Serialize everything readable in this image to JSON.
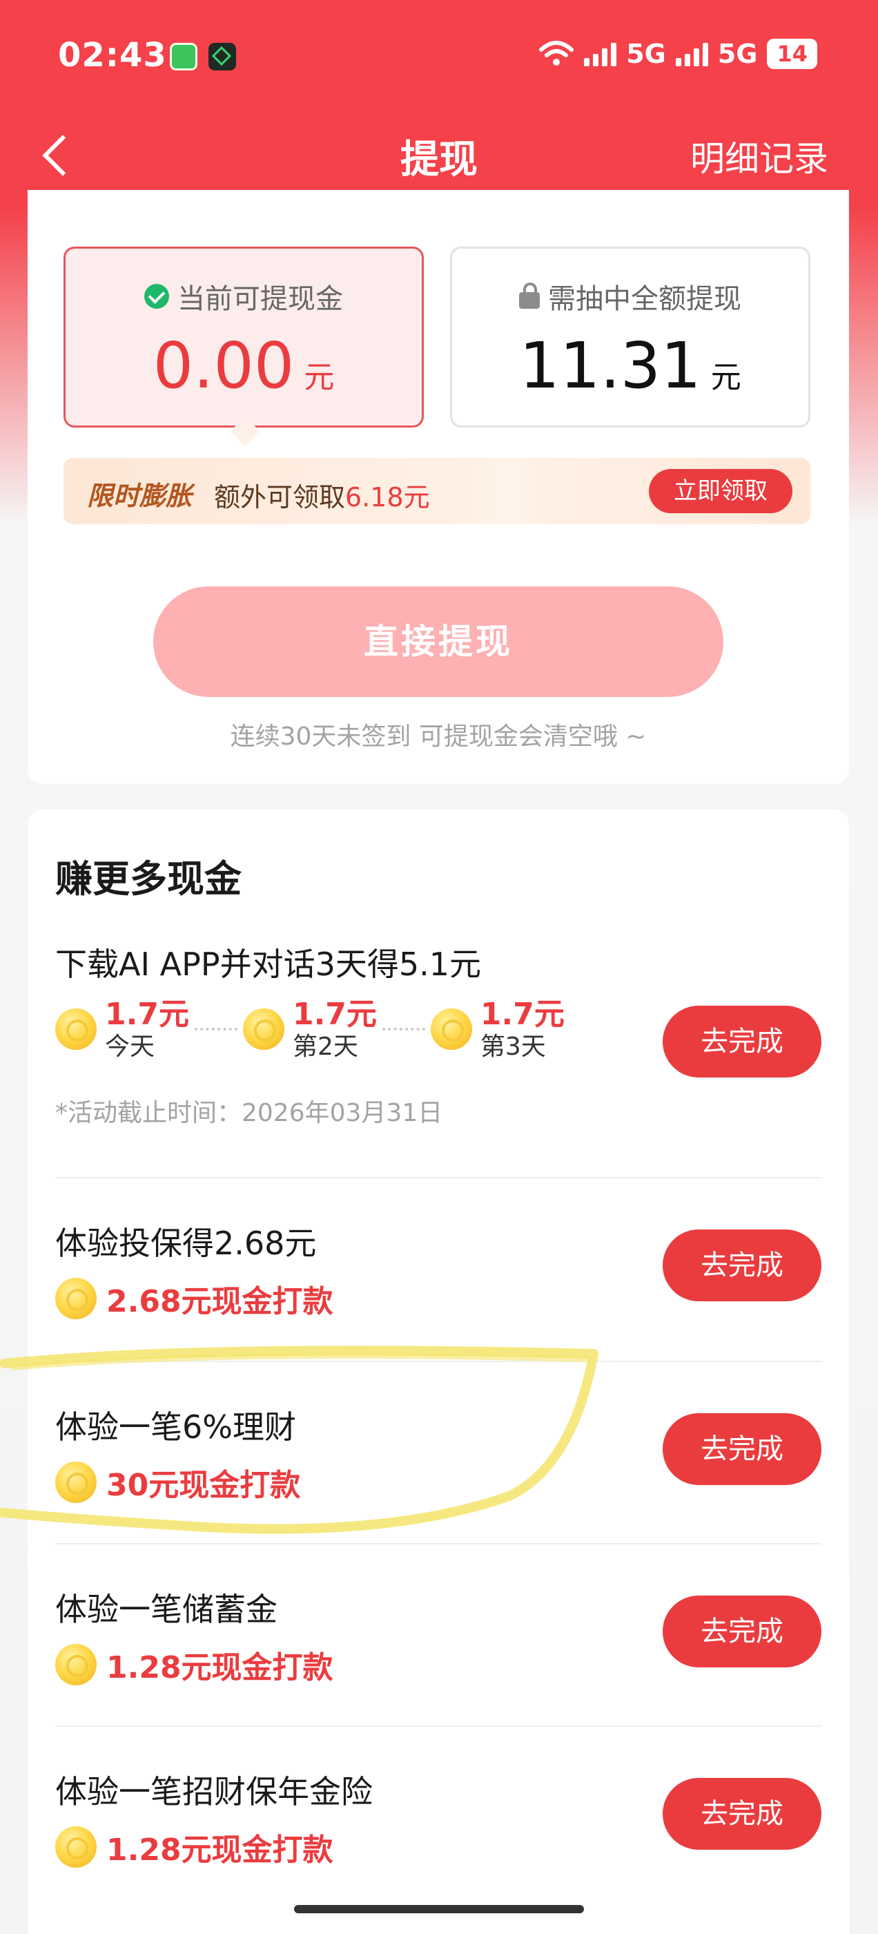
{
  "status_bar": {
    "time": "02:43",
    "network_1": "5G",
    "network_2": "5G",
    "battery": "14"
  },
  "header": {
    "title": "提现",
    "detail_link": "明细记录"
  },
  "balance": {
    "available_label": "当前可提现金",
    "available_amount": "0.00",
    "available_unit": "元",
    "locked_label": "需抽中全额提现",
    "locked_amount": "11.31",
    "locked_unit": "元"
  },
  "promo": {
    "tag": "限时膨胀",
    "text_prefix": "额外可领取",
    "text_amount": "6.18元",
    "button": "立即领取"
  },
  "withdraw": {
    "button": "直接提现",
    "hint": "连续30天未签到 可提现金会清空哦 ~"
  },
  "earn_more": {
    "title": "赚更多现金",
    "tasks": [
      {
        "name": "下载AI APP并对话3天得5.1元",
        "days": [
          {
            "value": "1.7元",
            "label": "今天"
          },
          {
            "value": "1.7元",
            "label": "第2天"
          },
          {
            "value": "1.7元",
            "label": "第3天"
          }
        ],
        "deadline": "*活动截止时间：2026年03月31日",
        "button": "去完成"
      },
      {
        "name": "体验投保得2.68元",
        "reward": "2.68元现金打款",
        "button": "去完成"
      },
      {
        "name": "体验一笔6%理财",
        "reward": "30元现金打款",
        "button": "去完成"
      },
      {
        "name": "体验一笔储蓄金",
        "reward": "1.28元现金打款",
        "button": "去完成"
      },
      {
        "name": "体验一笔招财保年金险",
        "reward": "1.28元现金打款",
        "button": "去完成"
      }
    ]
  },
  "icons": {
    "back": "chevron-left-icon",
    "check": "check-circle-icon",
    "lock": "lock-icon",
    "coin": "coin-icon"
  },
  "colors": {
    "brand_red": "#F4414A",
    "accent_red": "#EA3C3F",
    "disabled_button": "#FDB1B2",
    "highlight_yellow": "#F5E46A"
  }
}
